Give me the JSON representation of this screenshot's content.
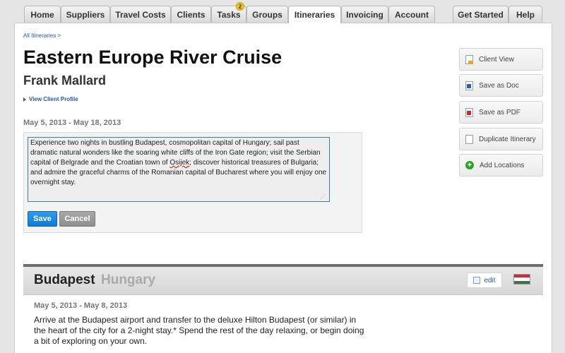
{
  "nav": {
    "tabs": [
      {
        "label": "Home"
      },
      {
        "label": "Suppliers"
      },
      {
        "label": "Travel Costs"
      },
      {
        "label": "Clients"
      },
      {
        "label": "Tasks",
        "badge": "2"
      },
      {
        "label": "Groups"
      },
      {
        "label": "Itineraries",
        "active": true
      },
      {
        "label": "Invoicing"
      },
      {
        "label": "Account"
      },
      {
        "label": "Get Started"
      },
      {
        "label": "Help"
      }
    ]
  },
  "breadcrumb": "All Itineraries >",
  "itinerary": {
    "title": "Eastern Europe River Cruise",
    "client_name": "Frank Mallard",
    "profile_link": "View Client Profile",
    "date_range": "May 5, 2013 - May 18, 2013",
    "description_part1": "Experience two nights in bustling Budapest, cosmopolitan capital of Hungary; sail past dramatic natural wonders like the soaring white cliffs of the Iron Gate region; visit the Serbian capital of Belgrade and the Croatian town of ",
    "description_misspelled": "Osijek",
    "description_part2": "; discover historical treasures of Bulgaria; and admire the graceful charms of the Romanian capital of Bucharest where you will enjoy one overnight stay.",
    "save_label": "Save",
    "cancel_label": "Cancel"
  },
  "side_actions": [
    {
      "label": "Client View",
      "icon": "client-view-icon"
    },
    {
      "label": "Save as Doc",
      "icon": "word-doc-icon"
    },
    {
      "label": "Save as PDF",
      "icon": "pdf-icon"
    },
    {
      "label": "Duplicate Itinerary",
      "icon": "duplicate-icon"
    },
    {
      "label": "Add Locations",
      "icon": "add-circle-icon",
      "glyph": "+"
    }
  ],
  "destination": {
    "city": "Budapest",
    "country": "Hungary",
    "edit_label": "edit",
    "date_range": "May 5, 2013 - May 8, 2013",
    "description": "Arrive at the Budapest airport and transfer to the deluxe Hilton Budapest (or similar) in the heart of the city for a 2-night stay.* Spend the rest of the day relaxing, or begin doing a bit of exploring on your own.",
    "flag_colors": [
      "#cd2a3e",
      "#ffffff",
      "#436f4d"
    ]
  },
  "colors": {
    "link": "#1f5aa8",
    "primary_button": "#1a8ae6",
    "secondary_button": "#999999",
    "textarea_border": "#3a7bbf"
  }
}
